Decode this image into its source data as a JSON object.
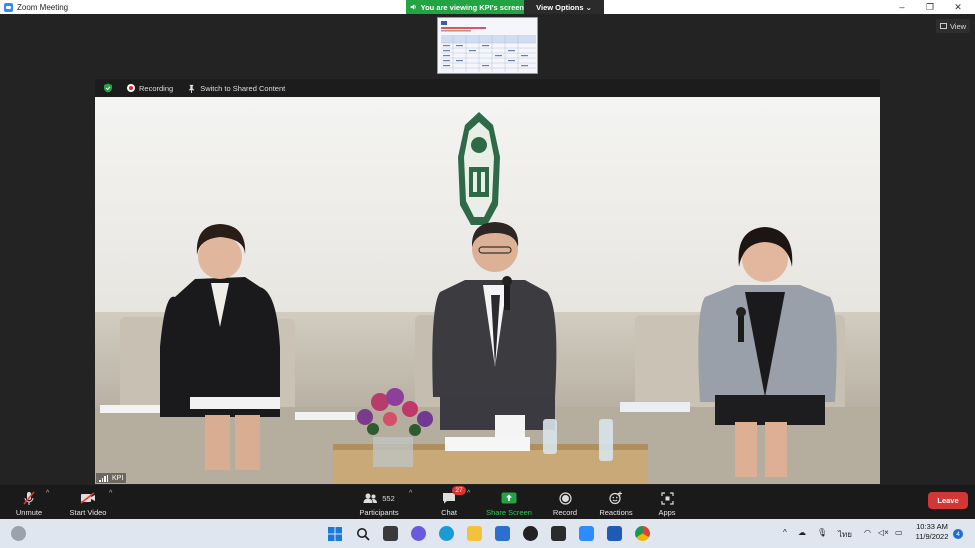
{
  "window": {
    "title": "Zoom Meeting",
    "minimize": "–",
    "restore": "❐",
    "close": "✕"
  },
  "banner": {
    "viewing_text": "You are viewing KPI's screen",
    "view_options": "View Options ⌄"
  },
  "view_button": "View",
  "meeting_bar": {
    "recording": "Recording",
    "switch_label": "Switch to Shared Content"
  },
  "video": {
    "participant_name": "KPI"
  },
  "toolbar": {
    "unmute": "Unmute",
    "start_video": "Start Video",
    "participants": "Participants",
    "participants_count": "552",
    "chat": "Chat",
    "chat_badge": "27",
    "share_screen": "Share Screen",
    "record": "Record",
    "reactions": "Reactions",
    "apps": "Apps",
    "leave": "Leave",
    "caret": "^"
  },
  "taskbar": {
    "time": "10:33 AM",
    "date": "11/9/2022",
    "language": "ไทย",
    "notifications": "4",
    "tray_caret": "^"
  },
  "colors": {
    "share_green": "#23a343",
    "leave_red": "#d23636",
    "zoom_blue": "#2d8cff",
    "toolbar_bg": "#1a1a1a",
    "taskbar_bg": "#dfe6ef"
  },
  "icons": [
    "zoom-logo-icon",
    "speaker-icon",
    "shield-icon",
    "record-icon",
    "pin-icon",
    "mic-muted-icon",
    "video-off-icon",
    "participants-icon",
    "chat-icon",
    "share-screen-icon",
    "record-button-icon",
    "reactions-icon",
    "apps-icon",
    "windows-start-icon",
    "search-icon",
    "file-explorer-icon",
    "edge-icon",
    "chrome-icon",
    "word-icon",
    "zoom-taskbar-icon",
    "wifi-icon",
    "volume-icon",
    "battery-icon"
  ]
}
